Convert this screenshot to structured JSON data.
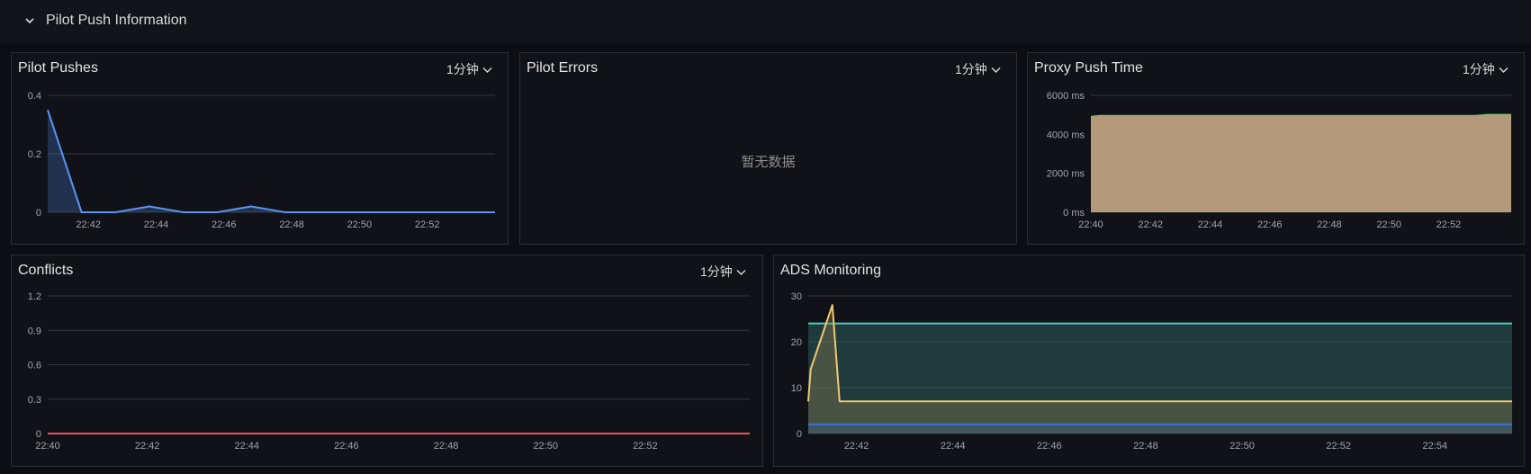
{
  "section": {
    "title": "Pilot Push Information"
  },
  "interval_label": "1分钟",
  "panels": {
    "pilot_pushes": {
      "title": "Pilot Pushes"
    },
    "pilot_errors": {
      "title": "Pilot Errors",
      "no_data": "暂无数据"
    },
    "proxy_push_time": {
      "title": "Proxy Push Time"
    },
    "conflicts": {
      "title": "Conflicts"
    },
    "ads_monitoring": {
      "title": "ADS Monitoring"
    }
  },
  "chart_data": [
    {
      "id": "pilot_pushes",
      "type": "area",
      "title": "Pilot Pushes",
      "xlabel": "",
      "ylabel": "",
      "x_ticks": [
        "22:42",
        "22:44",
        "22:46",
        "22:48",
        "22:50",
        "22:52"
      ],
      "y_ticks": [
        "0",
        "0.2",
        "0.4"
      ],
      "xlim": [
        40.8,
        54.0
      ],
      "ylim": [
        0,
        0.4
      ],
      "grid": true,
      "series": [
        {
          "color": "#5794f2",
          "x": [
            40.8,
            41.8,
            42.8,
            43.8,
            44.8,
            45.8,
            46.8,
            47.8,
            48.8,
            49.8,
            50.8,
            51.8,
            52.8,
            53.8,
            54.0
          ],
          "values": [
            0.35,
            0,
            0,
            0.02,
            0,
            0,
            0.02,
            0,
            0,
            0,
            0,
            0,
            0,
            0,
            0
          ]
        }
      ]
    },
    {
      "id": "pilot_errors",
      "type": "line",
      "title": "Pilot Errors",
      "series": []
    },
    {
      "id": "proxy_push_time",
      "type": "area",
      "title": "Proxy Push Time",
      "xlabel": "",
      "ylabel": "",
      "x_ticks": [
        "22:40",
        "22:42",
        "22:44",
        "22:46",
        "22:48",
        "22:50",
        "22:52"
      ],
      "y_ticks": [
        "0 ms",
        "2000 ms",
        "4000 ms",
        "6000 ms"
      ],
      "xlim": [
        40,
        54.1
      ],
      "ylim": [
        0,
        6000
      ],
      "grid": true,
      "series": [
        {
          "color": "#73bf69",
          "fill": "#b49a7a",
          "x": [
            40.0,
            40.3,
            52.9,
            53.3,
            54.1
          ],
          "values": [
            4900,
            4950,
            4950,
            5000,
            5000
          ]
        },
        {
          "color": "#b49a7a",
          "fill": "#b49a7a",
          "x": [
            40.0,
            40.3,
            52.9,
            53.3,
            54.1
          ],
          "values": [
            4850,
            4900,
            4900,
            4950,
            4950
          ]
        }
      ]
    },
    {
      "id": "conflicts",
      "type": "line",
      "title": "Conflicts",
      "xlabel": "",
      "ylabel": "",
      "x_ticks": [
        "22:40",
        "22:42",
        "22:44",
        "22:46",
        "22:48",
        "22:50",
        "22:52"
      ],
      "y_ticks": [
        "0",
        "0.3",
        "0.6",
        "0.9",
        "1.2"
      ],
      "xlim": [
        40,
        54.1
      ],
      "ylim": [
        0,
        1.2
      ],
      "grid": true,
      "series": [
        {
          "color": "#f2495c",
          "x": [
            40,
            54.1
          ],
          "values": [
            0,
            0
          ]
        }
      ]
    },
    {
      "id": "ads_monitoring",
      "type": "area",
      "title": "ADS Monitoring",
      "xlabel": "",
      "ylabel": "",
      "x_ticks": [
        "22:42",
        "22:44",
        "22:46",
        "22:48",
        "22:50",
        "22:52",
        "22:54"
      ],
      "y_ticks": [
        "0",
        "10",
        "20",
        "30"
      ],
      "xlim": [
        41.0,
        55.6
      ],
      "ylim": [
        0,
        30
      ],
      "grid": true,
      "series": [
        {
          "color": "#4ec9c0",
          "fill": "rgba(48,110,110,0.45)",
          "x": [
            41.0,
            55.6
          ],
          "values": [
            24,
            24
          ]
        },
        {
          "color": "#f2c96d",
          "fill": "rgba(150,130,80,0.35)",
          "x": [
            41.0,
            41.05,
            41.5,
            41.65,
            55.6
          ],
          "values": [
            7,
            14,
            28,
            7,
            7
          ]
        },
        {
          "color": "#3274d9",
          "fill": "rgba(50,90,150,0.3)",
          "x": [
            41.0,
            55.6
          ],
          "values": [
            2,
            2
          ]
        }
      ]
    }
  ]
}
